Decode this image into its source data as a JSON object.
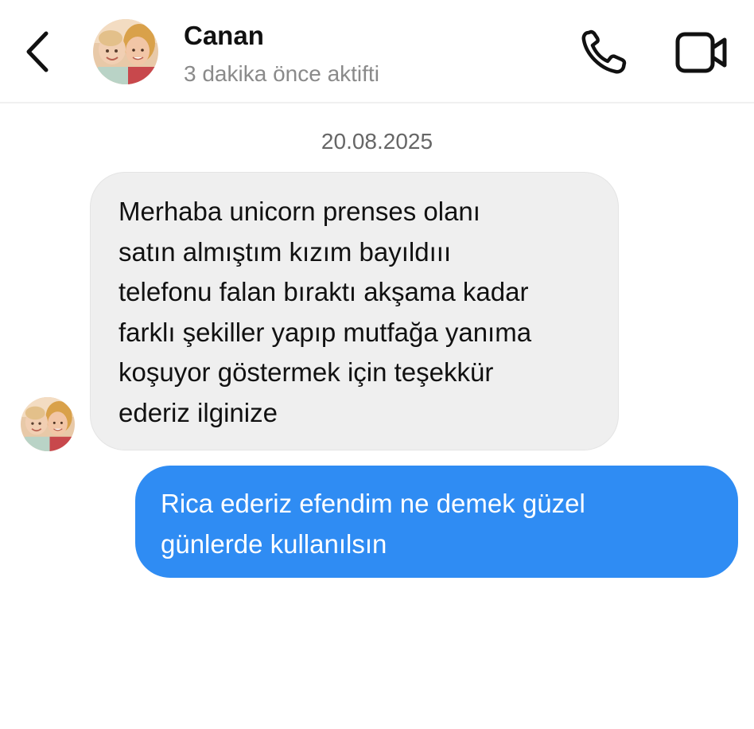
{
  "header": {
    "contact_name": "Canan",
    "status": "3 dakika önce aktifti",
    "icons": {
      "back": "chevron-left-icon",
      "call": "phone-icon",
      "video": "video-camera-icon"
    }
  },
  "conversation": {
    "date": "20.08.2025",
    "messages": [
      {
        "direction": "incoming",
        "text": "Merhaba unicorn prenses olanı\nsatın almıştım kızım bayıldııı\ntelefonu falan bıraktı akşama kadar\nfarklı şekiller yapıp mutfağa yanıma\nkoşuyor göstermek için teşekkür\nederiz ilginize"
      },
      {
        "direction": "outgoing",
        "text": "Rica ederiz efendim ne demek güzel\ngünlerde kullanılsın"
      }
    ]
  },
  "colors": {
    "incoming_bubble": "#efefef",
    "outgoing_bubble": "#2f8cf3",
    "status_text": "#8a8a8a",
    "date_text": "#666666"
  }
}
